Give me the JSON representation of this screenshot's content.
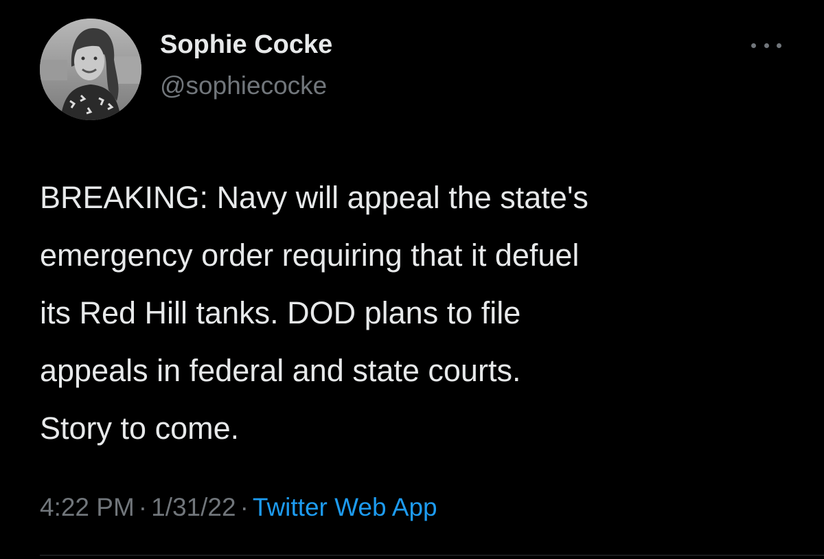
{
  "author": {
    "display_name": "Sophie Cocke",
    "handle": "@sophiecocke",
    "avatar_icon": "profile-photo"
  },
  "more_icon": "more-options-icon",
  "tweet": {
    "lines": [
      "BREAKING: Navy will appeal the state's",
      "emergency order requiring that it defuel",
      "its Red Hill tanks. DOD plans to file",
      "appeals in federal and state courts.",
      "Story to come."
    ]
  },
  "meta": {
    "time": "4:22 PM",
    "separator": "·",
    "date": "1/31/22",
    "source": "Twitter Web App"
  },
  "colors": {
    "background": "#000000",
    "text": "#e7e9ea",
    "secondary": "#71767b",
    "accent": "#1d9bf0"
  }
}
